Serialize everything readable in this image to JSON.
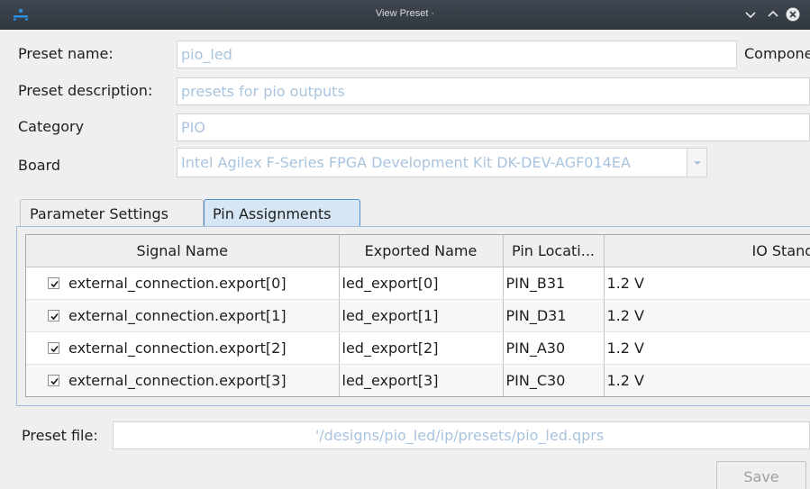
{
  "window": {
    "title": "View Preset ·",
    "controls": [
      "minimize-icon",
      "maximize-icon",
      "close-icon"
    ]
  },
  "form": {
    "preset_name_label": "Preset name:",
    "preset_name_value": "pio_led",
    "component_label": "Componen",
    "preset_description_label": "Preset description:",
    "preset_description_value": "presets for pio outputs",
    "category_label": "Category",
    "category_value": "PIO",
    "board_label": "Board",
    "board_value": "Intel Agilex F-Series FPGA Development Kit DK-DEV-AGF014EA"
  },
  "tabs": [
    {
      "label": "Parameter Settings",
      "selected": false
    },
    {
      "label": "Pin Assignments",
      "selected": true
    }
  ],
  "pin_table": {
    "columns": [
      "Signal Name",
      "Exported Name",
      "Pin Locati...",
      "IO Stand."
    ],
    "rows": [
      {
        "checked": true,
        "signal": "external_connection.export[0]",
        "exported": "led_export[0]",
        "pin": "PIN_B31",
        "io": "1.2 V"
      },
      {
        "checked": true,
        "signal": "external_connection.export[1]",
        "exported": "led_export[1]",
        "pin": "PIN_D31",
        "io": "1.2 V"
      },
      {
        "checked": true,
        "signal": "external_connection.export[2]",
        "exported": "led_export[2]",
        "pin": "PIN_A30",
        "io": "1.2 V"
      },
      {
        "checked": true,
        "signal": "external_connection.export[3]",
        "exported": "led_export[3]",
        "pin": "PIN_C30",
        "io": "1.2 V"
      }
    ]
  },
  "footer": {
    "preset_file_label": "Preset file:",
    "preset_file_value": "'/designs/pio_led/ip/presets/pio_led.qprs",
    "save_label": "Save"
  },
  "colors": {
    "titlebar": "#3a4049",
    "window_bg": "#efefef",
    "field_text": "#a9c4df",
    "active_tab": "#d7e6f5",
    "active_tab_border": "#4d8fd1"
  }
}
